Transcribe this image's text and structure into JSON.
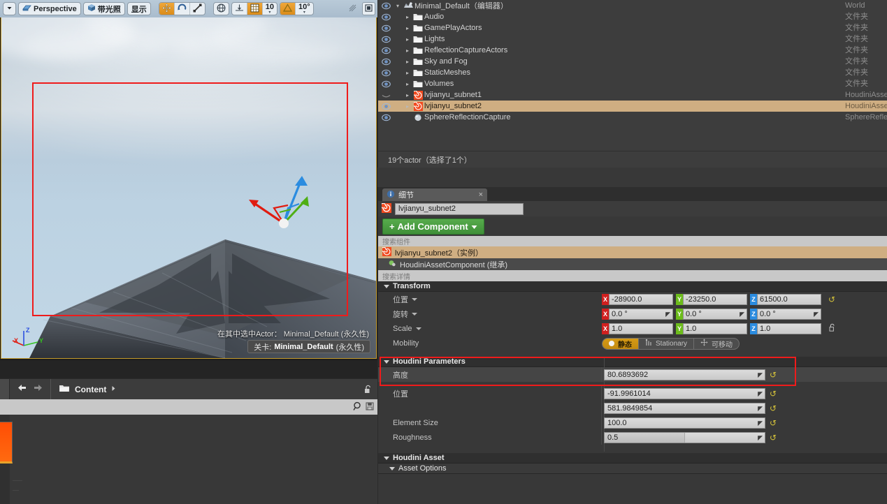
{
  "viewport": {
    "toolbar": {
      "dropdown_icon": "chevron-down-icon",
      "perspective_label": "Perspective",
      "perspective_icon": "camera-icon",
      "lit_label": "带光照",
      "lit_icon": "cube-icon",
      "show_label": "显示",
      "translate_icon": "move-gizmo-icon",
      "rotate_icon": "rotate-gizmo-icon",
      "scale_icon": "scale-gizmo-icon",
      "world_icon": "globe-icon",
      "surface_snap_icon": "surface-snap-icon",
      "grid_snap_icon": "grid-icon",
      "grid_value": "10",
      "angle_snap_icon": "angle-snap-icon",
      "angle_value": "10°",
      "camera_speed_icon": "camera-speed-icon",
      "maximize_icon": "maximize-icon"
    },
    "status_actor_line": "在其中选中Actor： Minimal_Default (永久性)",
    "level_prefix": "关卡:",
    "level_name": "Minimal_Default",
    "level_suffix": "(永久性)",
    "axis": {
      "x": "X",
      "y": "Y",
      "z": "Z"
    },
    "selection_box_color": "#ef1b1b"
  },
  "content_browser": {
    "back_icon": "arrow-left-icon",
    "forward_icon": "arrow-right-icon",
    "folder_icon": "folder-icon",
    "breadcrumb": "Content",
    "breadcrumb_arrow_icon": "chevron-right-icon",
    "lock_icon": "unlock-icon",
    "search_placeholder": "",
    "search_value": "",
    "search_icon": "search-icon",
    "save_icon": "save-icon"
  },
  "outliner": {
    "rows": [
      {
        "name": "Minimal_Default（编辑器）",
        "type": "World",
        "icon": "world-icon",
        "indent": 0,
        "twisty": "down",
        "eye": "eye-icon",
        "selected": false
      },
      {
        "name": "Audio",
        "type": "文件夹",
        "icon": "folder-icon",
        "indent": 1,
        "twisty": "right",
        "eye": "eye-icon",
        "selected": false
      },
      {
        "name": "GamePlayActors",
        "type": "文件夹",
        "icon": "folder-icon",
        "indent": 1,
        "twisty": "right",
        "eye": "eye-icon",
        "selected": false
      },
      {
        "name": "Lights",
        "type": "文件夹",
        "icon": "folder-icon",
        "indent": 1,
        "twisty": "right",
        "eye": "eye-icon",
        "selected": false
      },
      {
        "name": "ReflectionCaptureActors",
        "type": "文件夹",
        "icon": "folder-icon",
        "indent": 1,
        "twisty": "right",
        "eye": "eye-icon",
        "selected": false
      },
      {
        "name": "Sky and Fog",
        "type": "文件夹",
        "icon": "folder-icon",
        "indent": 1,
        "twisty": "right",
        "eye": "eye-icon",
        "selected": false
      },
      {
        "name": "StaticMeshes",
        "type": "文件夹",
        "icon": "folder-icon",
        "indent": 1,
        "twisty": "right",
        "eye": "eye-icon",
        "selected": false
      },
      {
        "name": "Volumes",
        "type": "文件夹",
        "icon": "folder-icon",
        "indent": 1,
        "twisty": "right",
        "eye": "eye-icon",
        "selected": false
      },
      {
        "name": "lvjianyu_subnet1",
        "type": "HoudiniAsset",
        "icon": "houdini-icon",
        "indent": 1,
        "twisty": "right",
        "eye": "eye-hidden-icon",
        "selected": false
      },
      {
        "name": "lvjianyu_subnet2",
        "type": "HoudiniAsset",
        "icon": "houdini-icon",
        "indent": 1,
        "twisty": "right",
        "eye": "eye-icon",
        "selected": true
      },
      {
        "name": "SphereReflectionCapture",
        "type": "SphereReflec",
        "icon": "sphere-reflection-icon",
        "indent": 1,
        "twisty": "none",
        "eye": "eye-icon",
        "selected": false
      }
    ],
    "status": "19个actor（选择了1个）"
  },
  "details": {
    "tab_label": "细节",
    "tab_icon": "info-icon",
    "tab_close_icon": "close-icon",
    "actor_icon": "houdini-icon",
    "actor_name": "lvjianyu_subnet2",
    "add_component_label": "Add Component",
    "add_component_plus": "+",
    "add_component_caret_icon": "chevron-down-icon",
    "component_search_placeholder": "搜索组件",
    "components": [
      {
        "label": "lvjianyu_subnet2（实例）",
        "icon": "houdini-icon",
        "selected": true
      },
      {
        "label": "HoudiniAssetComponent (继承)",
        "icon": "component-icon",
        "selected": false
      }
    ],
    "details_search_placeholder": "搜索详情",
    "transform": {
      "header": "Transform",
      "rows": [
        {
          "label": "位置",
          "has_caret": true,
          "x": "-28900.0",
          "y": "-23250.0",
          "z": "61500.0",
          "style": "plain",
          "reset": true
        },
        {
          "label": "旋转",
          "has_caret": true,
          "x": "0.0 °",
          "y": "0.0 °",
          "z": "0.0 °",
          "style": "drag",
          "reset": false
        },
        {
          "label": "Scale",
          "has_caret": true,
          "x": "1.0",
          "y": "1.0",
          "z": "1.0",
          "style": "plain",
          "lock": true
        }
      ],
      "mobility": {
        "label": "Mobility",
        "options": [
          {
            "label": "静态",
            "icon": "dot-icon",
            "active": true
          },
          {
            "label": "Stationary",
            "icon": "stationary-icon",
            "active": false
          },
          {
            "label": "可移动",
            "icon": "move-icon",
            "active": false
          }
        ]
      }
    },
    "houdini_parameters": {
      "header": "Houdini Parameters",
      "highlighted": true,
      "highlight_color": "#ef1b1b",
      "rows": [
        {
          "label": "高度",
          "value": "80.6893692",
          "type": "number",
          "caret_after": 2,
          "reset": true,
          "highlighted": true
        },
        {
          "label": "位置",
          "value": "-91.9961014",
          "type": "number",
          "reset": true,
          "span_label": true
        },
        {
          "label": "",
          "value": "581.9849854",
          "type": "number",
          "reset": true
        },
        {
          "label": "Element Size",
          "value": "100.0",
          "type": "number",
          "caret_after": 3,
          "reset": true
        },
        {
          "label": "Roughness",
          "value": "0.5",
          "type": "slider",
          "slider_pct": 50,
          "reset": true
        }
      ]
    },
    "houdini_asset": {
      "header": "Houdini Asset",
      "sub_header": "Asset Options"
    }
  }
}
